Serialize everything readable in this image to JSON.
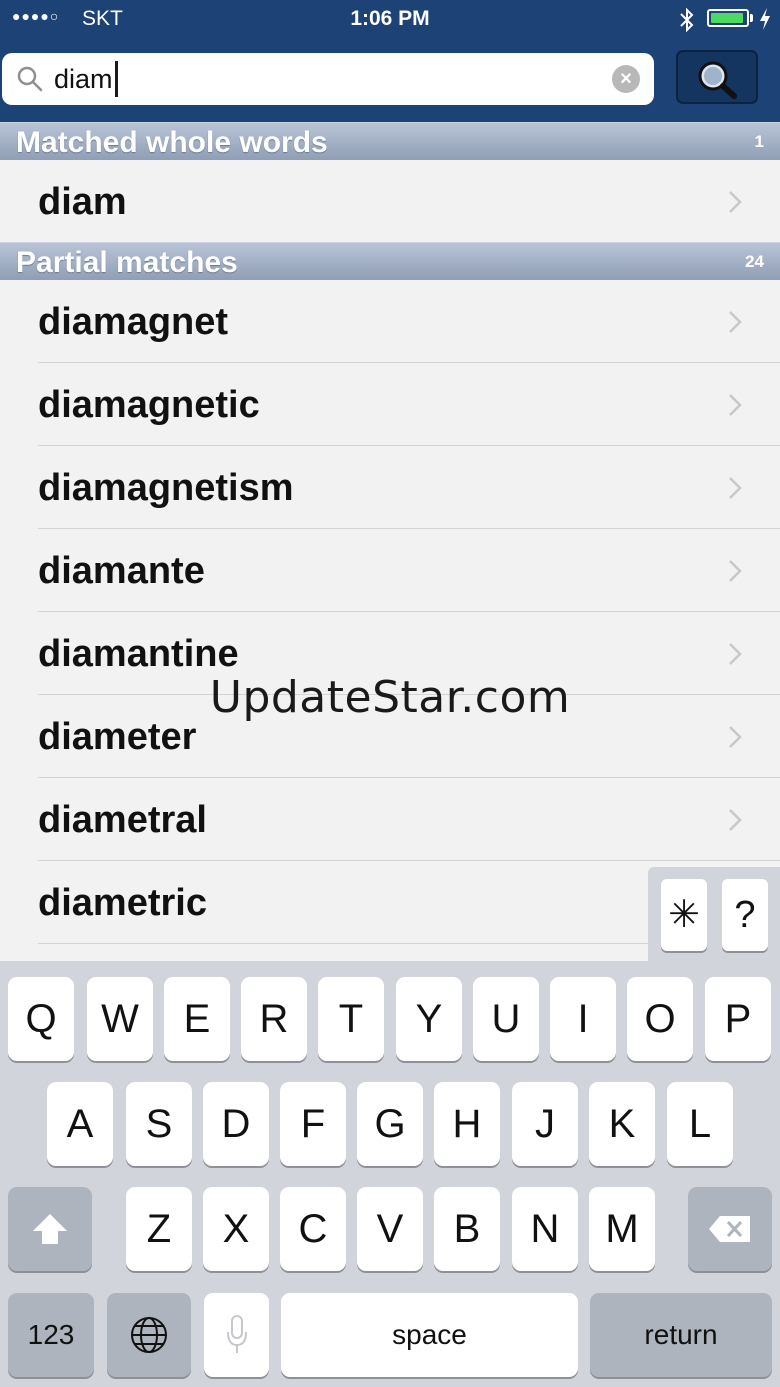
{
  "status_bar": {
    "signal_dots": "●●●●○",
    "carrier": "SKT",
    "time": "1:06 PM",
    "battery_level": 0.95
  },
  "search": {
    "query": "diam"
  },
  "sections": [
    {
      "title": "Matched whole words",
      "count": "1",
      "items": [
        "diam"
      ]
    },
    {
      "title": "Partial matches",
      "count": "24",
      "items": [
        "diamagnet",
        "diamagnetic",
        "diamagnetism",
        "diamante",
        "diamantine",
        "diameter",
        "diametral",
        "diametric"
      ]
    }
  ],
  "watermark": "UpdateStar.com",
  "accessory_keys": [
    "✳",
    "?"
  ],
  "keyboard": {
    "row1": [
      "Q",
      "W",
      "E",
      "R",
      "T",
      "Y",
      "U",
      "I",
      "O",
      "P"
    ],
    "row2": [
      "A",
      "S",
      "D",
      "F",
      "G",
      "H",
      "J",
      "K",
      "L"
    ],
    "row3": [
      "Z",
      "X",
      "C",
      "V",
      "B",
      "N",
      "M"
    ],
    "numbers_key": "123",
    "space_key": "space",
    "return_key": "return"
  },
  "colors": {
    "nav_bar": "#1d4275",
    "section_header": "#9aa8be",
    "battery": "#4cd964"
  }
}
